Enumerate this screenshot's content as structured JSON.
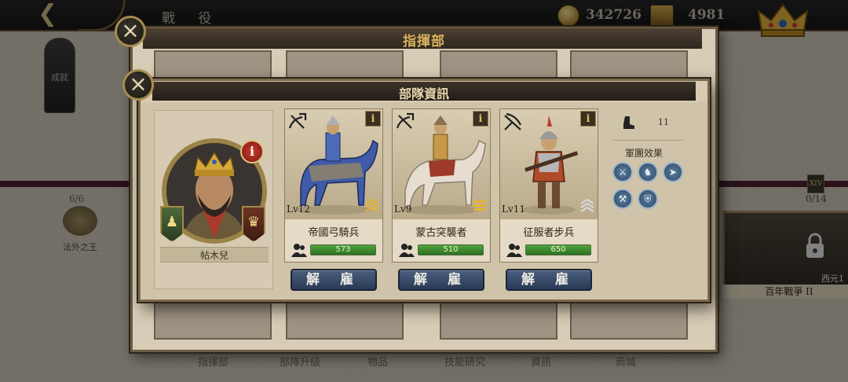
{
  "topbar": {
    "title": "戰 役",
    "coins": "342726",
    "banners": "4981"
  },
  "sidebar": {
    "achievements_label": "成就"
  },
  "timeline": {
    "left_node": {
      "progress": "6/6",
      "label": "法外之王"
    },
    "right_node": {
      "badge": "XIV",
      "progress": "0/14",
      "year": "西元1",
      "label": "百年戰爭 II"
    }
  },
  "bottom_labels": [
    "指揮部",
    "部隊升級",
    "物品",
    "技能研究",
    "資訊",
    "商城"
  ],
  "hq_panel": {
    "title": "指揮部"
  },
  "unit_dialog": {
    "title": "部隊資訊",
    "general": {
      "name": "帖木兒",
      "info_label": "i"
    },
    "units": [
      {
        "name": "帝國弓騎兵",
        "level": "Lv12",
        "soldiers": "573",
        "fill": 1.0,
        "info_label": "i",
        "type_icon": "mounted-archer-icon",
        "rank": "gold-chevron"
      },
      {
        "name": "蒙古突襲者",
        "level": "Lv9",
        "soldiers": "510",
        "fill": 1.0,
        "info_label": "i",
        "type_icon": "mounted-archer-icon",
        "rank": "gold-bars"
      },
      {
        "name": "征服者步兵",
        "level": "Lv11",
        "soldiers": "650",
        "fill": 1.0,
        "info_label": "i",
        "type_icon": "crossbow-icon",
        "rank": "silver-chevron"
      }
    ],
    "dismiss_label": "解 雇",
    "stats": {
      "march_speed": "11",
      "legion_effects_label": "軍團效果",
      "effect_icons": [
        "infantry-icon",
        "cavalry-icon",
        "archer-icon",
        "siege-icon",
        "shield-icon"
      ]
    }
  },
  "colors": {
    "accent_gold": "#d9b25c",
    "bar_green": "#3f8f30",
    "button_blue": "#3a4e6e"
  }
}
